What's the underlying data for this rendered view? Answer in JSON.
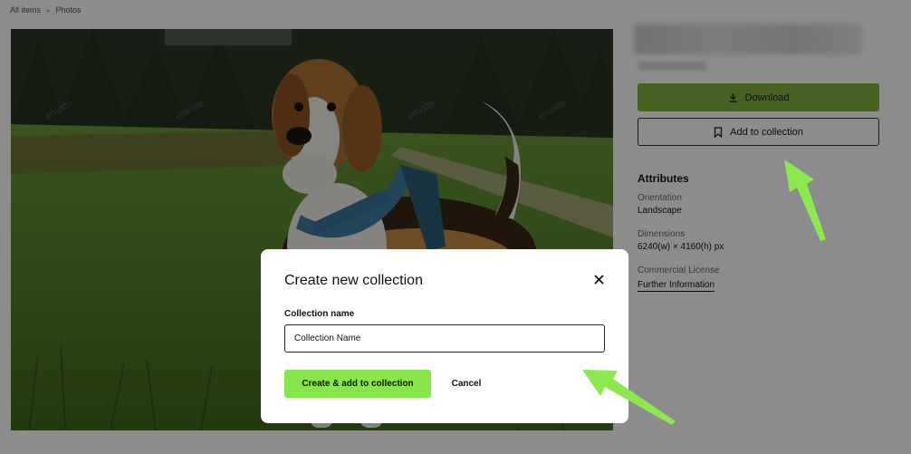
{
  "breadcrumb": {
    "root": "All items",
    "separator": "»",
    "current": "Photos"
  },
  "photo": {
    "watermark": "envato"
  },
  "actions": {
    "download_label": "Download",
    "download_icon": "download-icon",
    "add_to_collection_label": "Add to collection",
    "add_to_collection_icon": "bookmark-icon"
  },
  "attributes": {
    "heading": "Attributes",
    "orientation_label": "Orientation",
    "orientation_value": "Landscape",
    "dimensions_label": "Dimensions",
    "dimensions_value": "6240(w) × 4160(h) px",
    "license_label": "Commercial License",
    "license_link": "Further Information"
  },
  "modal": {
    "title": "Create new collection",
    "close_icon": "close-icon",
    "field_label": "Collection name",
    "field_value": "Collection Name",
    "create_label": "Create & add to collection",
    "cancel_label": "Cancel"
  },
  "colors": {
    "download_button": "#82b541",
    "create_button": "#87e64b",
    "annotation_arrow": "#8be84f",
    "overlay": "rgba(0,0,0,0.45)"
  }
}
